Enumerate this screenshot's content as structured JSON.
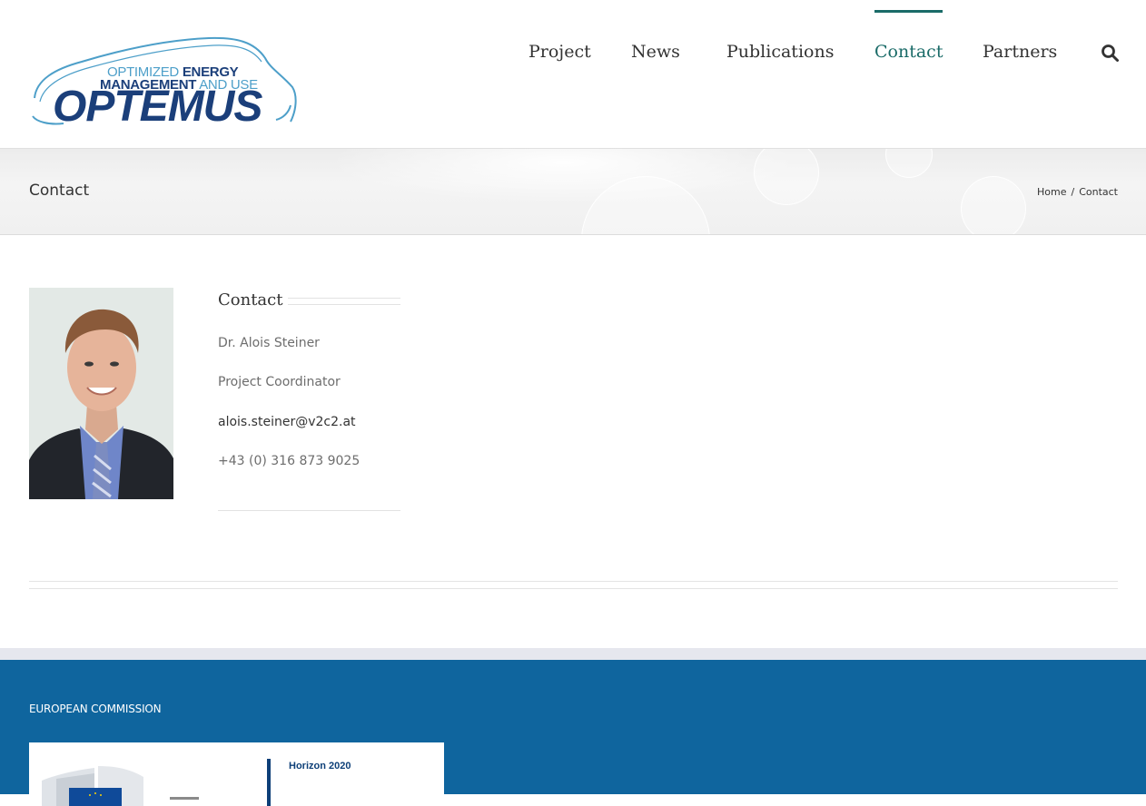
{
  "logo": {
    "line1_thin": "OPTIMIZED ",
    "line1_bold": "ENERGY",
    "line2_bold": "MANAGEMENT",
    "line2_thin": " AND USE",
    "wordmark": "OPTEMUS",
    "colors": {
      "dark": "#1b3f7a",
      "light": "#4d9fc9"
    }
  },
  "nav": {
    "items": [
      {
        "label": "Project"
      },
      {
        "label": "News"
      },
      {
        "label": "Publications"
      },
      {
        "label": "Contact"
      },
      {
        "label": "Partners"
      }
    ],
    "active": "Contact",
    "active_color": "#1a6b68",
    "search_icon": "search-icon"
  },
  "page_title_bar": {
    "title": "Contact",
    "breadcrumb": {
      "home": "Home",
      "separator": "/",
      "current": "Contact"
    }
  },
  "contact": {
    "heading": "Contact",
    "name": "Dr. Alois Steiner",
    "role": "Project Coordinator",
    "email": "alois.steiner@v2c2.at",
    "phone": "+43 (0) 316 873 9025"
  },
  "footer": {
    "heading": "EUROPEAN COMMISSION",
    "logo_text": "Horizon 2020",
    "background": "#0f659e"
  }
}
